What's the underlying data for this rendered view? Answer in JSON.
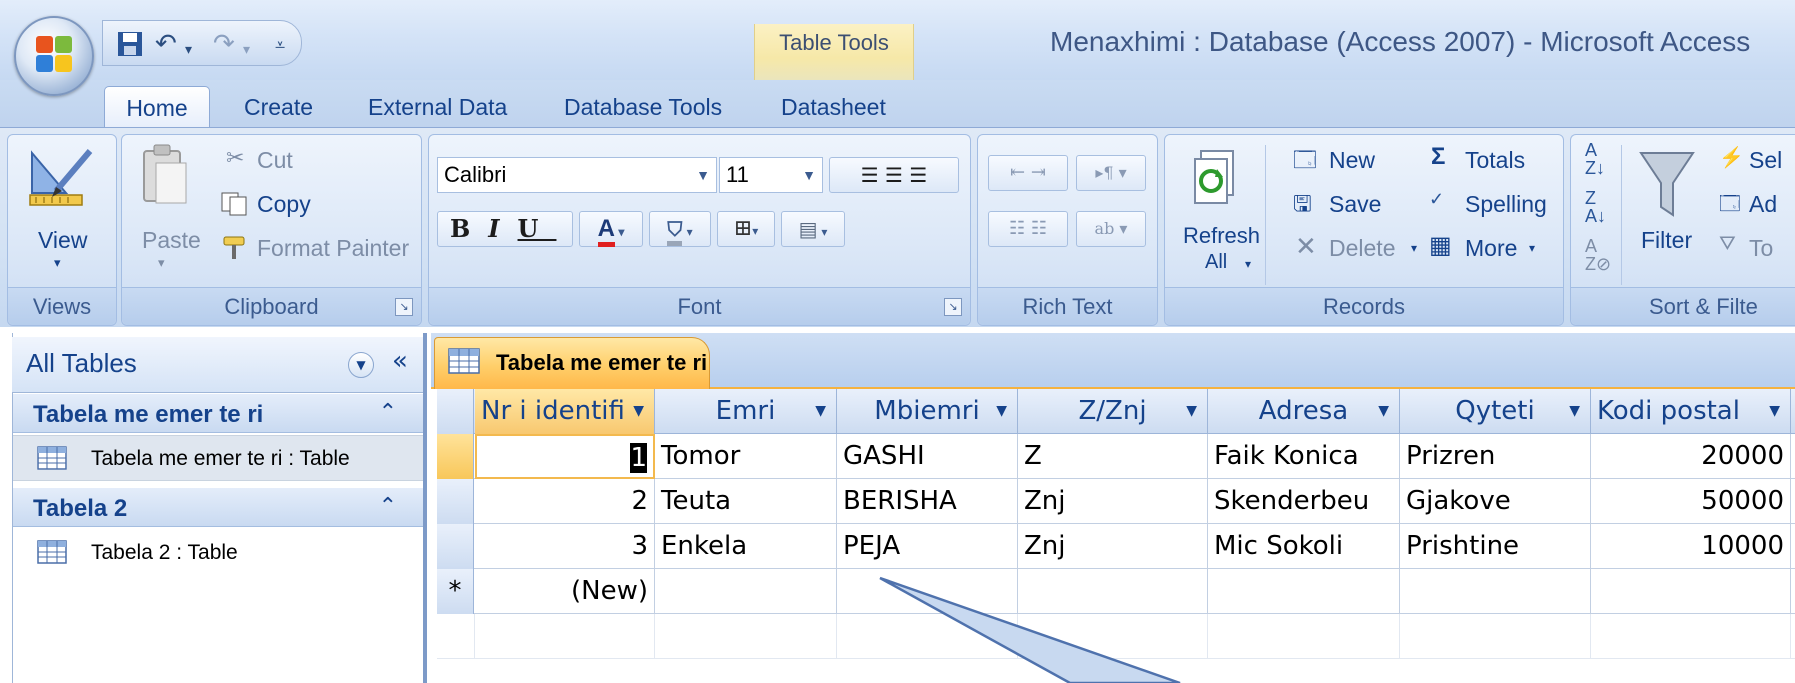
{
  "window": {
    "title": "Menaxhimi : Database (Access 2007) - Microsoft Access",
    "context_tab_group": "Table Tools"
  },
  "ribbon_tabs": [
    "Home",
    "Create",
    "External Data",
    "Database Tools",
    "Datasheet"
  ],
  "groups": {
    "views": {
      "label": "Views",
      "view": "View"
    },
    "clipboard": {
      "label": "Clipboard",
      "paste": "Paste",
      "cut": "Cut",
      "copy": "Copy",
      "format_painter": "Format Painter"
    },
    "font": {
      "label": "Font",
      "font_name": "Calibri",
      "font_size": "11",
      "bold": "B",
      "italic": "I",
      "underline": "U",
      "font_color": "A"
    },
    "rich_text": {
      "label": "Rich Text"
    },
    "records": {
      "label": "Records",
      "refresh": "Refresh",
      "refresh_sub": "All",
      "new": "New",
      "save": "Save",
      "delete": "Delete",
      "totals": "Totals",
      "spelling": "Spelling",
      "more": "More"
    },
    "sort_filter": {
      "label": "Sort & Filte",
      "filter": "Filter",
      "selection": "Sel",
      "advanced": "Ad",
      "toggle": "To"
    }
  },
  "nav": {
    "title": "All Tables",
    "groups": [
      {
        "title": "Tabela me emer te ri",
        "item": "Tabela me emer te ri : Table"
      },
      {
        "title": "Tabela 2",
        "item": "Tabela 2 : Table"
      }
    ]
  },
  "document": {
    "tab_label": "Tabela me emer te ri",
    "columns": [
      "Nr i identifi",
      "Emri",
      "Mbiemri",
      "Z/Znj",
      "Adresa",
      "Qyteti",
      "Kodi postal"
    ],
    "rows": [
      [
        "1",
        "Tomor",
        "GASHI",
        "Z",
        "Faik Konica",
        "Prizren",
        "20000"
      ],
      [
        "2",
        "Teuta",
        "BERISHA",
        "Znj",
        "Skenderbeu",
        "Gjakove",
        "50000"
      ],
      [
        "3",
        "Enkela",
        "PEJA",
        "Znj",
        "Mic Sokoli",
        "Prishtine",
        "10000"
      ]
    ],
    "new_row_label": "(New)",
    "new_row_marker": "*"
  },
  "colors": {
    "ribbon": "#d3e2f4",
    "accent_tab": "#ffcf6a",
    "text": "#15428b"
  }
}
